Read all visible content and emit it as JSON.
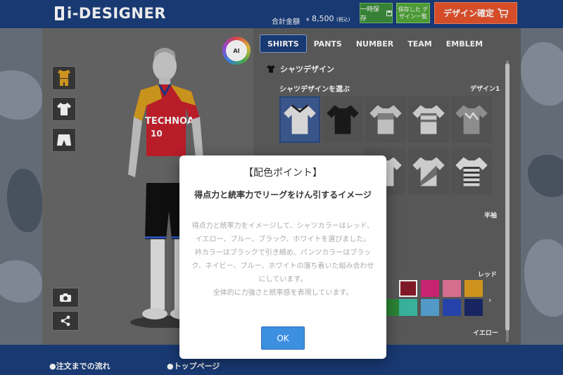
{
  "header": {
    "logo_text": "i-DESIGNER",
    "total_label": "合計金額",
    "total_currency": "¥",
    "total_price": "8,500",
    "total_tax": "(税込)",
    "save_temp_label": "一時保存",
    "save_list_label": "保存した デザイン一覧",
    "confirm_label": "デザイン確定"
  },
  "ai_badge": {
    "label": "AI"
  },
  "tabs": [
    {
      "label": "SHIRTS",
      "active": true
    },
    {
      "label": "PANTS",
      "active": false
    },
    {
      "label": "NUMBER",
      "active": false
    },
    {
      "label": "TEAM",
      "active": false
    },
    {
      "label": "EMBLEM",
      "active": false
    }
  ],
  "design": {
    "section_title": "シャツデザイン",
    "choose_label": "シャツデザインを選ぶ",
    "design_number": "デザイン1",
    "sleeve_label": "半袖",
    "color_red_label": "レッド",
    "color_yellow_label": "イエロー"
  },
  "player": {
    "team_name": "TECHNOA",
    "number": "10"
  },
  "footer": {
    "link_flow": "●注文までの流れ",
    "link_top": "●トップページ"
  },
  "modal": {
    "title": "【配色ポイント】",
    "subtitle": "得点力と統率力でリーグをけん引するイメージ",
    "body_1": "得点力と統率力をイメージして、シャツカラーはレッド、イエロー、ブルー、ブラック、ホワイトを選びました。",
    "body_2": "衿カラーはブラックで引き締め、パンツカラーはブラック、ネイビー、ブルー、ホワイトの落ち着いた組み合わせにしています。",
    "body_3": "全体的に力強さと統率感を表現しています。",
    "ok_label": "OK"
  },
  "colors": {
    "brand": "#1b3e7c",
    "save_green": "#3b8c3a",
    "confirm_orange": "#e8532d",
    "ok_blue": "#3d8fe0"
  },
  "swatch_colors_row1": [
    "#8b1c2a",
    "#d8267a",
    "#e8789c",
    "#e0a020"
  ],
  "swatch_colors_row2": [
    "#2f8f3a",
    "#3cc0a8",
    "#5aa6d8",
    "#2848b8",
    "#1a2a6a"
  ]
}
